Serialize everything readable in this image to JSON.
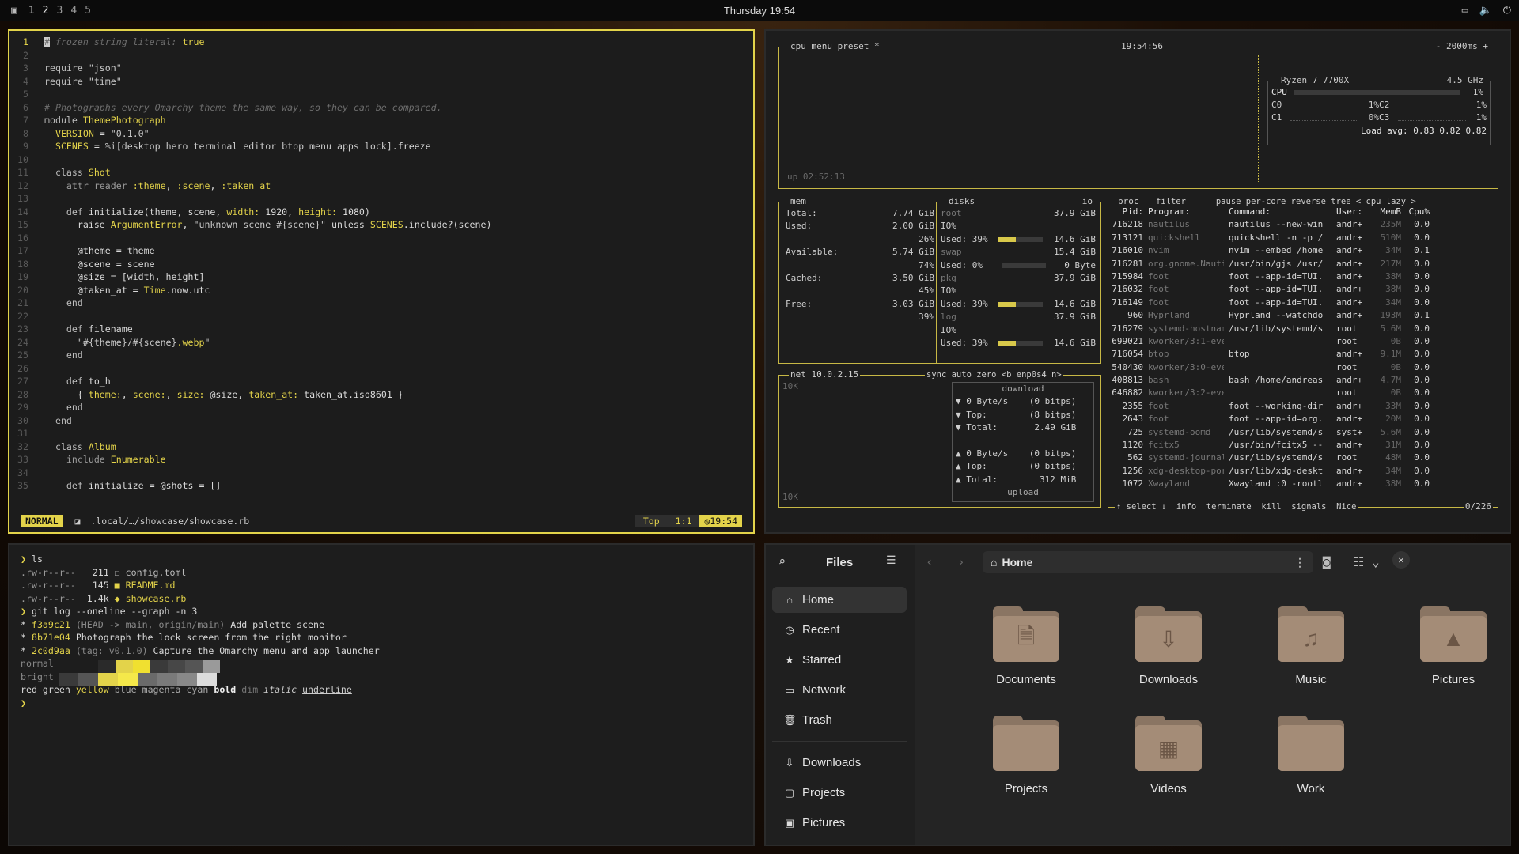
{
  "topbar": {
    "workspaces": [
      "1",
      "2",
      "3",
      "4",
      "5"
    ],
    "clock": "Thursday 19:54"
  },
  "editor": {
    "lines": [
      {
        "n": "1",
        "parts": [
          [
            "c-com",
            "# frozen_string_literal: "
          ],
          [
            "c-y",
            "true"
          ]
        ]
      },
      {
        "n": "2",
        "parts": []
      },
      {
        "n": "3",
        "parts": [
          [
            "c-kw",
            "require "
          ],
          [
            "c-str",
            "\"json\""
          ]
        ]
      },
      {
        "n": "4",
        "parts": [
          [
            "c-kw",
            "require "
          ],
          [
            "c-str",
            "\"time\""
          ]
        ]
      },
      {
        "n": "5",
        "parts": []
      },
      {
        "n": "6",
        "parts": [
          [
            "c-com",
            "# Photographs every Omarchy theme the same way, so they can be compared."
          ]
        ]
      },
      {
        "n": "7",
        "parts": [
          [
            "c-kw",
            "module "
          ],
          [
            "c-y",
            "ThemePhotograph"
          ]
        ]
      },
      {
        "n": "8",
        "parts": [
          [
            "c-y",
            "  VERSION"
          ],
          [
            "c-w",
            " = "
          ],
          [
            "c-str",
            "\"0.1.0\""
          ]
        ]
      },
      {
        "n": "9",
        "parts": [
          [
            "c-y",
            "  SCENES"
          ],
          [
            "c-w",
            " = "
          ],
          [
            "c-str",
            "%i[desktop hero terminal editor btop menu apps lock]"
          ],
          [
            "c-w",
            ".freeze"
          ]
        ]
      },
      {
        "n": "10",
        "parts": []
      },
      {
        "n": "11",
        "parts": [
          [
            "c-kw",
            "  class "
          ],
          [
            "c-y",
            "Shot"
          ]
        ]
      },
      {
        "n": "12",
        "parts": [
          [
            "c-g",
            "    attr_reader "
          ],
          [
            "c-y",
            ":theme"
          ],
          [
            "c-w",
            ", "
          ],
          [
            "c-y",
            ":scene"
          ],
          [
            "c-w",
            ", "
          ],
          [
            "c-y",
            ":taken_at"
          ]
        ]
      },
      {
        "n": "13",
        "parts": []
      },
      {
        "n": "14",
        "parts": [
          [
            "c-kw",
            "    def "
          ],
          [
            "c-w",
            "initialize(theme, scene, "
          ],
          [
            "c-y",
            "width:"
          ],
          [
            "c-w",
            " 1920, "
          ],
          [
            "c-y",
            "height:"
          ],
          [
            "c-w",
            " 1080)"
          ]
        ]
      },
      {
        "n": "15",
        "parts": [
          [
            "c-w",
            "      raise "
          ],
          [
            "c-y",
            "ArgumentError"
          ],
          [
            "c-w",
            ", "
          ],
          [
            "c-str",
            "\"unknown scene #{scene}\""
          ],
          [
            "c-w",
            " unless "
          ],
          [
            "c-y",
            "SCENES"
          ],
          [
            "c-w",
            ".include?(scene)"
          ]
        ]
      },
      {
        "n": "16",
        "parts": []
      },
      {
        "n": "17",
        "parts": [
          [
            "c-w",
            "      @theme = theme"
          ]
        ]
      },
      {
        "n": "18",
        "parts": [
          [
            "c-w",
            "      @scene = scene"
          ]
        ]
      },
      {
        "n": "19",
        "parts": [
          [
            "c-w",
            "      @size = [width, height]"
          ]
        ]
      },
      {
        "n": "20",
        "parts": [
          [
            "c-w",
            "      @taken_at = "
          ],
          [
            "c-y",
            "Time"
          ],
          [
            "c-w",
            ".now.utc"
          ]
        ]
      },
      {
        "n": "21",
        "parts": [
          [
            "c-kw",
            "    end"
          ]
        ]
      },
      {
        "n": "22",
        "parts": []
      },
      {
        "n": "23",
        "parts": [
          [
            "c-kw",
            "    def "
          ],
          [
            "c-w",
            "filename"
          ]
        ]
      },
      {
        "n": "24",
        "parts": [
          [
            "c-str",
            "      \"#{theme}/#{scene}"
          ],
          [
            "c-y",
            ".webp"
          ],
          [
            "c-str",
            "\""
          ]
        ]
      },
      {
        "n": "25",
        "parts": [
          [
            "c-kw",
            "    end"
          ]
        ]
      },
      {
        "n": "26",
        "parts": []
      },
      {
        "n": "27",
        "parts": [
          [
            "c-kw",
            "    def "
          ],
          [
            "c-w",
            "to_h"
          ]
        ]
      },
      {
        "n": "28",
        "parts": [
          [
            "c-w",
            "      { "
          ],
          [
            "c-y",
            "theme:"
          ],
          [
            "c-w",
            ", "
          ],
          [
            "c-y",
            "scene:"
          ],
          [
            "c-w",
            ", "
          ],
          [
            "c-y",
            "size:"
          ],
          [
            "c-w",
            " @size, "
          ],
          [
            "c-y",
            "taken_at:"
          ],
          [
            "c-w",
            " taken_at.iso8601 }"
          ]
        ]
      },
      {
        "n": "29",
        "parts": [
          [
            "c-kw",
            "    end"
          ]
        ]
      },
      {
        "n": "30",
        "parts": [
          [
            "c-kw",
            "  end"
          ]
        ]
      },
      {
        "n": "31",
        "parts": []
      },
      {
        "n": "32",
        "parts": [
          [
            "c-kw",
            "  class "
          ],
          [
            "c-y",
            "Album"
          ]
        ]
      },
      {
        "n": "33",
        "parts": [
          [
            "c-g",
            "    include "
          ],
          [
            "c-y",
            "Enumerable"
          ]
        ]
      },
      {
        "n": "34",
        "parts": []
      },
      {
        "n": "35",
        "parts": [
          [
            "c-kw",
            "    def "
          ],
          [
            "c-w",
            "initialize = @shots = []"
          ]
        ]
      }
    ],
    "status": {
      "mode": "NORMAL",
      "path": ".local/…/showcase/showcase.rb",
      "pos": "Top",
      "cursor": "1:1",
      "time": "19:54"
    }
  },
  "btop": {
    "cpu": {
      "menu": [
        "cpu",
        "menu",
        "preset *"
      ],
      "time": "19:54:56",
      "interval": "- 2000ms +",
      "uptime": "up 02:52:13",
      "model": "Ryzen 7 7700X",
      "freq": "4.5 GHz",
      "load": "Load avg: 0.83 0.82 0.82",
      "cores": [
        {
          "l": "CPU",
          "v": "1%"
        },
        {
          "l": "C0",
          "v": "1%"
        },
        {
          "l": "C2",
          "v": "1%"
        },
        {
          "l": "C1",
          "v": "0%"
        },
        {
          "l": "C3",
          "v": "1%"
        }
      ]
    },
    "mem": {
      "title": "mem",
      "disks": "disks",
      "io": "io",
      "rows": [
        {
          "k": "Total:",
          "v": "7.74 GiB"
        },
        {
          "k": "Used:",
          "v": "2.00 GiB"
        },
        {
          "k": "",
          "v": "26%"
        },
        {
          "k": "Available:",
          "v": "5.74 GiB"
        },
        {
          "k": "",
          "v": "74%"
        },
        {
          "k": "Cached:",
          "v": "3.50 GiB"
        },
        {
          "k": "",
          "v": "45%"
        },
        {
          "k": "Free:",
          "v": "3.03 GiB"
        },
        {
          "k": "",
          "v": "39%"
        }
      ],
      "disk_rows": [
        {
          "k": "root",
          "v": "37.9 GiB"
        },
        {
          "k": "IO%",
          "v": ""
        },
        {
          "k": "Used: 39%",
          "v": "14.6 GiB",
          "bar": 0.39
        },
        {
          "k": "swap",
          "v": "15.4 GiB"
        },
        {
          "k": "Used:  0%",
          "v": "0 Byte",
          "bar": 0
        },
        {
          "k": "pkg",
          "v": "37.9 GiB"
        },
        {
          "k": "IO%",
          "v": ""
        },
        {
          "k": "Used: 39%",
          "v": "14.6 GiB",
          "bar": 0.39
        },
        {
          "k": "log",
          "v": "37.9 GiB"
        },
        {
          "k": "IO%",
          "v": ""
        },
        {
          "k": "Used: 39%",
          "v": "14.6 GiB",
          "bar": 0.39
        }
      ]
    },
    "net": {
      "title": "net",
      "ip": "10.0.2.15",
      "opts": "sync auto zero <b enp0s4 n>",
      "top": "10K",
      "bottom": "10K",
      "rows": [
        "download",
        "▼ 0 Byte/s    (0 bitps)",
        "▼ Top:        (8 bitps)",
        "▼ Total:       2.49 GiB",
        "",
        "▲ 0 Byte/s    (0 bitps)",
        "▲ Top:        (0 bitps)",
        "▲ Total:        312 MiB",
        "upload"
      ]
    },
    "proc": {
      "title": "proc",
      "header": "filter      pause per-core reverse tree < cpu lazy >",
      "cols": [
        "Pid:",
        "Program:",
        "Command:",
        "User:",
        "MemB",
        "Cpu%"
      ],
      "rows": [
        [
          "716218",
          "nautilus",
          "nautilus --new-win",
          "andr+",
          "235M",
          "0.0"
        ],
        [
          "713121",
          "quickshell",
          "quickshell -n -p /",
          "andr+",
          "510M",
          "0.0"
        ],
        [
          "716010",
          "nvim",
          "nvim --embed /home",
          "andr+",
          "34M",
          "0.1"
        ],
        [
          "716281",
          "org.gnome.Nauti",
          "/usr/bin/gjs /usr/",
          "andr+",
          "217M",
          "0.0"
        ],
        [
          "715984",
          "foot",
          "foot --app-id=TUI.",
          "andr+",
          "38M",
          "0.0"
        ],
        [
          "716032",
          "foot",
          "foot --app-id=TUI.",
          "andr+",
          "38M",
          "0.0"
        ],
        [
          "716149",
          "foot",
          "foot --app-id=TUI.",
          "andr+",
          "34M",
          "0.0"
        ],
        [
          "960",
          "Hyprland",
          "Hyprland --watchdo",
          "andr+",
          "193M",
          "0.1"
        ],
        [
          "716279",
          "systemd-hostnam",
          "/usr/lib/systemd/s",
          "root",
          "5.6M",
          "0.0"
        ],
        [
          "699021",
          "kworker/3:1-even",
          "",
          "root",
          "0B",
          "0.0"
        ],
        [
          "716054",
          "btop",
          "btop",
          "andr+",
          "9.1M",
          "0.0"
        ],
        [
          "540430",
          "kworker/3:0-even",
          "",
          "root",
          "0B",
          "0.0"
        ],
        [
          "408813",
          "bash",
          "bash /home/andreas",
          "andr+",
          "4.7M",
          "0.0"
        ],
        [
          "646882",
          "kworker/3:2-even",
          "",
          "root",
          "0B",
          "0.0"
        ],
        [
          "2355",
          "foot",
          "foot --working-dir",
          "andr+",
          "33M",
          "0.0"
        ],
        [
          "2643",
          "foot",
          "foot --app-id=org.",
          "andr+",
          "20M",
          "0.0"
        ],
        [
          "725",
          "systemd-oomd",
          "/usr/lib/systemd/s",
          "syst+",
          "5.6M",
          "0.0"
        ],
        [
          "1120",
          "fcitx5",
          "/usr/bin/fcitx5 --",
          "andr+",
          "31M",
          "0.0"
        ],
        [
          "562",
          "systemd-journal",
          "/usr/lib/systemd/s",
          "root",
          "48M",
          "0.0"
        ],
        [
          "1256",
          "xdg-desktop-por",
          "/usr/lib/xdg-deskt",
          "andr+",
          "34M",
          "0.0"
        ],
        [
          "1072",
          "Xwayland",
          "Xwayland :0 -rootl",
          "andr+",
          "38M",
          "0.0"
        ]
      ],
      "footer": "↑ select ↓  info  terminate  kill  signals  Nice",
      "count": "0/226"
    }
  },
  "terminal": {
    "lines": [
      [
        [
          "#e3d34a",
          "❯ "
        ],
        [
          "#d8d8d8",
          "ls"
        ]
      ],
      [
        [
          "#9a9a9a",
          ".rw-r--r--  "
        ],
        [
          "#d8d8d8",
          " 211 "
        ],
        [
          "#bbb",
          "☐ config.toml"
        ]
      ],
      [
        [
          "#9a9a9a",
          ".rw-r--r--  "
        ],
        [
          "#d8d8d8",
          " 145 "
        ],
        [
          "#e3d34a",
          "■ README.md"
        ]
      ],
      [
        [
          "#9a9a9a",
          ".rw-r--r--  "
        ],
        [
          "#d8d8d8",
          "1.4k "
        ],
        [
          "#e3d34a",
          "◆ showcase.rb"
        ]
      ],
      [
        [
          "#e3d34a",
          "❯ "
        ],
        [
          "#d8d8d8",
          "git log --oneline --graph -n 3"
        ]
      ],
      [
        [
          "#d8d8d8",
          "* "
        ],
        [
          "#e3d34a",
          "f3a9c21 "
        ],
        [
          "#8a8a8a",
          "(HEAD -> main, origin/main) "
        ],
        [
          "#d8d8d8",
          "Add palette scene"
        ]
      ],
      [
        [
          "#d8d8d8",
          "* "
        ],
        [
          "#e3d34a",
          "8b71e04 "
        ],
        [
          "#d8d8d8",
          "Photograph the lock screen from the right monitor"
        ]
      ],
      [
        [
          "#d8d8d8",
          "* "
        ],
        [
          "#e3d34a",
          "2c0d9aa "
        ],
        [
          "#8a8a8a",
          "(tag: v0.1.0) "
        ],
        [
          "#d8d8d8",
          "Capture the Omarchy menu and app launcher"
        ]
      ],
      [
        [
          "#8a8a8a",
          "normal"
        ]
      ],
      [
        [
          "#8a8a8a",
          "bright"
        ]
      ],
      [
        [
          "#d8d8d8",
          "red "
        ],
        [
          "#d8d8d8",
          "green "
        ],
        [
          "#e3d34a",
          "yellow "
        ],
        [
          "#aaa",
          "blue "
        ],
        [
          "#aaa",
          "magenta "
        ],
        [
          "#aaa",
          "cyan "
        ],
        [
          "#eee",
          "bold "
        ],
        [
          "#777",
          "dim "
        ],
        [
          "#ccc",
          "italic "
        ],
        [
          "#ccc",
          "underline"
        ]
      ],
      [
        [
          "#e3d34a",
          "❯"
        ]
      ]
    ],
    "palette_normal": [
      "#1d1d1d",
      "#2a2a2a",
      "#e3d34a",
      "#f0e030",
      "#3a3a3a",
      "#474747",
      "#555",
      "#9a9a9a"
    ],
    "palette_bright": [
      "#3a3a3a",
      "#555",
      "#e3d34a",
      "#f5e84a",
      "#6a6a6a",
      "#7a7a7a",
      "#888",
      "#dcdcdc"
    ]
  },
  "files": {
    "title": "Files",
    "location": "Home",
    "sidebar": [
      {
        "label": "Home",
        "icon": "home-icon",
        "glyph": "⌂"
      },
      {
        "label": "Recent",
        "icon": "clock-icon",
        "glyph": "◷"
      },
      {
        "label": "Starred",
        "icon": "star-icon",
        "glyph": "★"
      },
      {
        "label": "Network",
        "icon": "network-icon",
        "glyph": "▭"
      },
      {
        "label": "Trash",
        "icon": "trash-icon",
        "glyph": "🗑"
      },
      {
        "label": "Downloads",
        "icon": "download-icon",
        "glyph": "⇩"
      },
      {
        "label": "Projects",
        "icon": "folder-icon",
        "glyph": "▢"
      },
      {
        "label": "Pictures",
        "icon": "picture-icon",
        "glyph": "▣"
      }
    ],
    "folders": [
      {
        "label": "Documents",
        "glyph": "🗎"
      },
      {
        "label": "Downloads",
        "glyph": "⇩"
      },
      {
        "label": "Music",
        "glyph": "♫"
      },
      {
        "label": "Pictures",
        "glyph": "▲"
      },
      {
        "label": "Projects",
        "glyph": ""
      },
      {
        "label": "Videos",
        "glyph": "▦"
      },
      {
        "label": "Work",
        "glyph": ""
      }
    ]
  }
}
